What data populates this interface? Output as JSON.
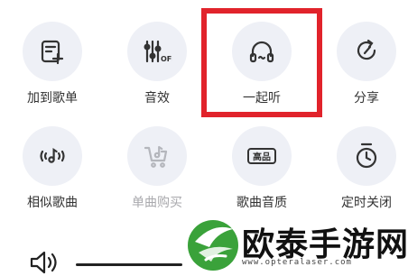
{
  "menu": {
    "items": [
      {
        "label": "加到歌单",
        "icon": "add-to-playlist-icon",
        "enabled": true
      },
      {
        "label": "音效",
        "icon": "sound-effect-off-icon",
        "enabled": true
      },
      {
        "label": "一起听",
        "icon": "headphones-icon",
        "enabled": true
      },
      {
        "label": "分享",
        "icon": "share-icon",
        "enabled": true
      },
      {
        "label": "相似歌曲",
        "icon": "similar-songs-icon",
        "enabled": true
      },
      {
        "label": "单曲购买",
        "icon": "shopping-cart-icon",
        "enabled": false
      },
      {
        "label": "歌曲音质",
        "icon": "quality-icon",
        "enabled": true
      },
      {
        "label": "定时关闭",
        "icon": "timer-icon",
        "enabled": true
      }
    ],
    "sound_effect_badge": "OFF",
    "quality_badge": "高品"
  },
  "volume": {
    "level_fraction": 0.35
  },
  "watermark": {
    "name": "欧泰手游网",
    "url": "www.opteralaser.com"
  },
  "colors": {
    "highlight": "#e1232b",
    "brand_green": "#3aa23a"
  }
}
